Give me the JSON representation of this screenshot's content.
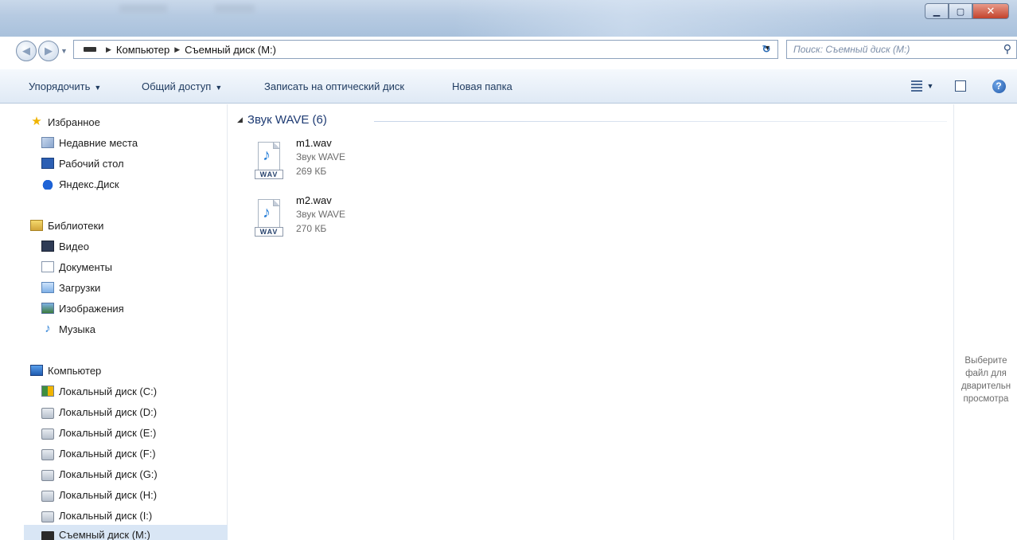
{
  "address": {
    "crumbs": [
      "Компьютер",
      "Съемный диск (M:)"
    ]
  },
  "search": {
    "placeholder": "Поиск: Съемный диск (M:)"
  },
  "toolbar": {
    "organize": "Упорядочить",
    "share": "Общий доступ",
    "burn": "Записать на оптический диск",
    "new_folder": "Новая папка"
  },
  "nav": {
    "favorites": {
      "label": "Избранное",
      "items": [
        "Недавние места",
        "Рабочий стол",
        "Яндекс.Диск"
      ]
    },
    "libraries": {
      "label": "Библиотеки",
      "items": [
        "Видео",
        "Документы",
        "Загрузки",
        "Изображения",
        "Музыка"
      ]
    },
    "computer": {
      "label": "Компьютер",
      "items": [
        "Локальный диск (C:)",
        "Локальный диск (D:)",
        "Локальный диск (E:)",
        "Локальный диск (F:)",
        "Локальный диск (G:)",
        "Локальный диск (H:)",
        "Локальный диск (I:)",
        "Съемный диск (M:)"
      ]
    }
  },
  "content": {
    "group_header": "Звук WAVE (6)",
    "files": [
      {
        "name": "m1.wav",
        "type": "Звук WAVE",
        "size": "269 КБ",
        "badge": "WAV"
      },
      {
        "name": "m2.wav",
        "type": "Звук WAVE",
        "size": "270 КБ",
        "badge": "WAV"
      }
    ]
  },
  "preview": {
    "text": "Выберите\nфайл для\nдварительн\nпросмотра"
  },
  "colors": {
    "accent": "#1e3b73",
    "selection": "#d9e6f5"
  }
}
